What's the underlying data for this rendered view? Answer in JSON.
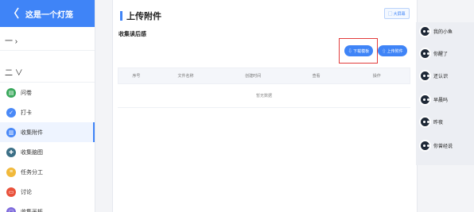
{
  "sidebar": {
    "header_title": "这是一个灯笼",
    "back_symbol": "〈",
    "group1": "一 ›",
    "group2": "二 ∨",
    "items": [
      {
        "label": "问卷",
        "color": "#3aa85c",
        "icon": "doc-icon",
        "glyph": "▤"
      },
      {
        "label": "打卡",
        "color": "#4a89f7",
        "icon": "checkin-icon",
        "glyph": "✓"
      },
      {
        "label": "收集附件",
        "color": "#4a89f7",
        "icon": "attachment-icon",
        "glyph": "▥",
        "active": true
      },
      {
        "label": "收集脑图",
        "color": "#3b6f86",
        "icon": "mindmap-icon",
        "glyph": "✚"
      },
      {
        "label": "任务分工",
        "color": "#f1b93b",
        "icon": "task-icon",
        "glyph": "≡"
      },
      {
        "label": "讨论",
        "color": "#e9513b",
        "icon": "discussion-icon",
        "glyph": "▭"
      },
      {
        "label": "收集画板",
        "color": "#7f6bdc",
        "icon": "canvas-icon",
        "glyph": "▢"
      }
    ]
  },
  "main": {
    "title": "上传附件",
    "bigscreen_label": "▢ 大屏幕",
    "subtitle": "收集读后感",
    "btn_template": "⇩ 下载模板",
    "btn_upload": "⇧ 上传附件",
    "table": {
      "headers": [
        "序号",
        "文件名称",
        "创建时间",
        "查看",
        "操作"
      ],
      "empty_text": "暂无数据"
    }
  },
  "right_list": [
    "我的小鱼",
    "你醒了",
    "还认识",
    "早晨吗",
    "昨夜",
    "你曾经说"
  ],
  "colors": {
    "accent": "#3f84f7",
    "highlight": "#e23b3b"
  }
}
